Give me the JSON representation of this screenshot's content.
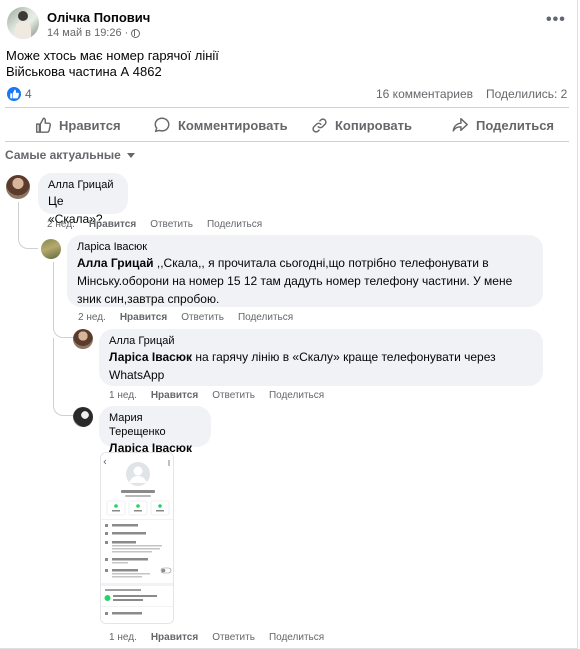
{
  "post": {
    "author": "Олічка Попович",
    "date": "14 май в 19:26 ·",
    "more_glyph": "•••",
    "lines": [
      "Може хтось має номер гарячої лінії",
      "Військова частина А 4862"
    ],
    "reactions_count": "4",
    "comments_count": "16 комментариев",
    "shares_count": "Поделились: 2"
  },
  "actions": {
    "like": "Нравится",
    "comment": "Комментировать",
    "copy": "Копировать",
    "share": "Поделиться"
  },
  "sort_label": "Самые актуальные",
  "comments": [
    {
      "name": "Алла Грицай",
      "mention": "",
      "text": "Це «Скала»?",
      "time": "2 нед.",
      "like": "Нравится",
      "reply": "Ответить",
      "share": "Поделиться"
    },
    {
      "name": "Ларіса Івасюк",
      "mention": "Алла Грицай",
      "text_1": " ,,Скала,, я прочитала сьогодні,що потрібно телефонувати в",
      "text_2": "Мінську.оборони на номер 15 12 там дадуть номер телефону частини. У мене",
      "text_3": "зник син,завтра спробою.",
      "time": "2 нед.",
      "like": "Нравится",
      "reply": "Ответить",
      "share": "Поделиться"
    },
    {
      "name": "Алла Грицай",
      "mention": "Ларіса Івасюк",
      "text_1": " на гарячу лінію в «Скалу» краще телефонувати через",
      "text_2": "WhatsApp",
      "time": "1 нед.",
      "like": "Нравится",
      "reply": "Ответить",
      "share": "Поделиться"
    },
    {
      "name": "Мария Терещенко",
      "mention": "Ларіса Івасюк",
      "time": "1 нед.",
      "like": "Нравится",
      "reply": "Ответить",
      "share": "Поделиться"
    }
  ],
  "attachment": {
    "contact_name": "Володимир ЦВС Скала",
    "phone": "+380 95 306 1123",
    "buttons": [
      "Аудіо",
      "Відео",
      "Пошук"
    ],
    "items": [
      "Сповіщення",
      "Видимість медіафайлів",
      "Шифрування",
      "Тимчасові повідомлення",
      "Закрити бесіду",
      "Спільні групи з контактом Володимир ЦВС Скала",
      "Додати до обраного"
    ]
  },
  "colors": {
    "accent": "#1877f2",
    "muted": "#65676b",
    "bubble": "#f0f2f5",
    "whatsapp_green": "#25d366"
  }
}
